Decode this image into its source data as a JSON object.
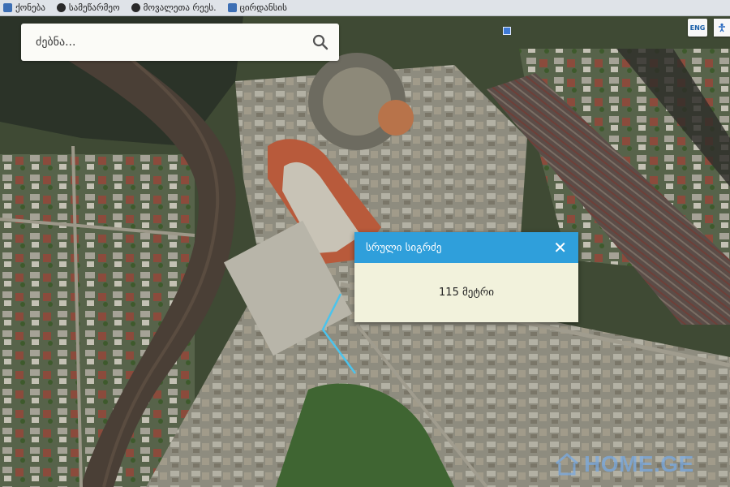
{
  "bookmarks": [
    {
      "label": "ქონება",
      "icon": "grid-icon"
    },
    {
      "label": "სამეწარმეო",
      "icon": "globe-icon"
    },
    {
      "label": "მოვალეთა რეეს.",
      "icon": "globe-icon"
    },
    {
      "label": "ცირდანსის",
      "icon": "folder-icon"
    }
  ],
  "search": {
    "placeholder": "ძებნა..."
  },
  "language": {
    "label": "ENG"
  },
  "popup": {
    "title": "სრული სიგრძე",
    "close_glyph": "✕",
    "value": "115 მეტრი"
  },
  "watermark": {
    "text": "HOME.GE"
  },
  "colors": {
    "popup_header": "#2f9fdb",
    "measure_line": "#4cc3ec",
    "popup_body": "#f2f2dc"
  }
}
